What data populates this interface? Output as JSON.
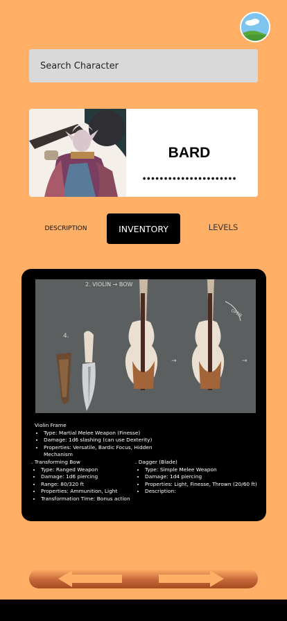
{
  "search": {
    "placeholder": "Search Character",
    "value": ""
  },
  "character": {
    "class_name": "BARD"
  },
  "tabs": [
    {
      "label": "DESCRIPTION",
      "active": false
    },
    {
      "label": "INVENTORY",
      "active": true
    },
    {
      "label": "LEVELS",
      "active": false
    }
  ],
  "inventory": {
    "concept_labels": {
      "title": "2. VIOLIN → BOW",
      "dagger_step": "4.",
      "open": "OPEN"
    },
    "violin_frame": {
      "title": "Violin Frame",
      "props": [
        "Type: Martial Melee Weapon (Finesse)",
        "Damage: 1d6 slashing (can use Dexterity)",
        "Properties: Versatile, Bardic Focus, Hidden Mechanism"
      ]
    },
    "transforming_bow": {
      "title": ". Transforming Bow",
      "props": [
        "Type: Ranged Weapon",
        "Damage: 1d6 piercing",
        "Range: 80/320 ft",
        "Properties: Ammunition, Light",
        "Transformation Time: Bonus action"
      ]
    },
    "dagger": {
      "title": ". Dagger (Blade)",
      "props": [
        "Type: Simple Melee Weapon",
        "Damage: 1d4 piercing",
        "Properties: Light, Finesse, Thrown (20/60 ft)",
        "Description:"
      ]
    }
  },
  "nav": {
    "prev_icon": "arrow-left-icon",
    "next_icon": "arrow-right-icon"
  },
  "colors": {
    "background": "#ffb066",
    "panel": "#000000",
    "search_bg": "#d9d9d9",
    "active_tab": "#000000"
  }
}
